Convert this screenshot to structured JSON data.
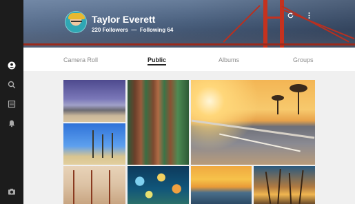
{
  "profile": {
    "name": "Taylor Everett",
    "followers_label": "220 Followers",
    "separator": "—",
    "following_label": "Following 64"
  },
  "tabs": [
    {
      "label": "Camera Roll",
      "active": false
    },
    {
      "label": "Public",
      "active": true
    },
    {
      "label": "Albums",
      "active": false
    },
    {
      "label": "Groups",
      "active": false
    }
  ],
  "sidebar": {
    "items": [
      {
        "icon": "profile-icon"
      },
      {
        "icon": "search-icon"
      },
      {
        "icon": "news-icon"
      },
      {
        "icon": "bell-icon"
      }
    ],
    "bottom_icon": "camera-icon"
  },
  "header_actions": [
    {
      "icon": "refresh-icon"
    },
    {
      "icon": "more-icon"
    }
  ],
  "photos": [
    {
      "subject": "purple sky over desert"
    },
    {
      "subject": "redwood forest"
    },
    {
      "subject": "sunset road with palm trees"
    },
    {
      "subject": "palm trees blue sky"
    },
    {
      "subject": "pier posts at sunset"
    },
    {
      "subject": "bokeh city lights"
    },
    {
      "subject": "sea at sunset"
    },
    {
      "subject": "grass silhouette at sunset"
    }
  ],
  "colors": {
    "sidebar": "#1c1c1c",
    "bridge": "#c4321f",
    "tab_active": "#222222",
    "tab_inactive": "#8a8a8a"
  }
}
